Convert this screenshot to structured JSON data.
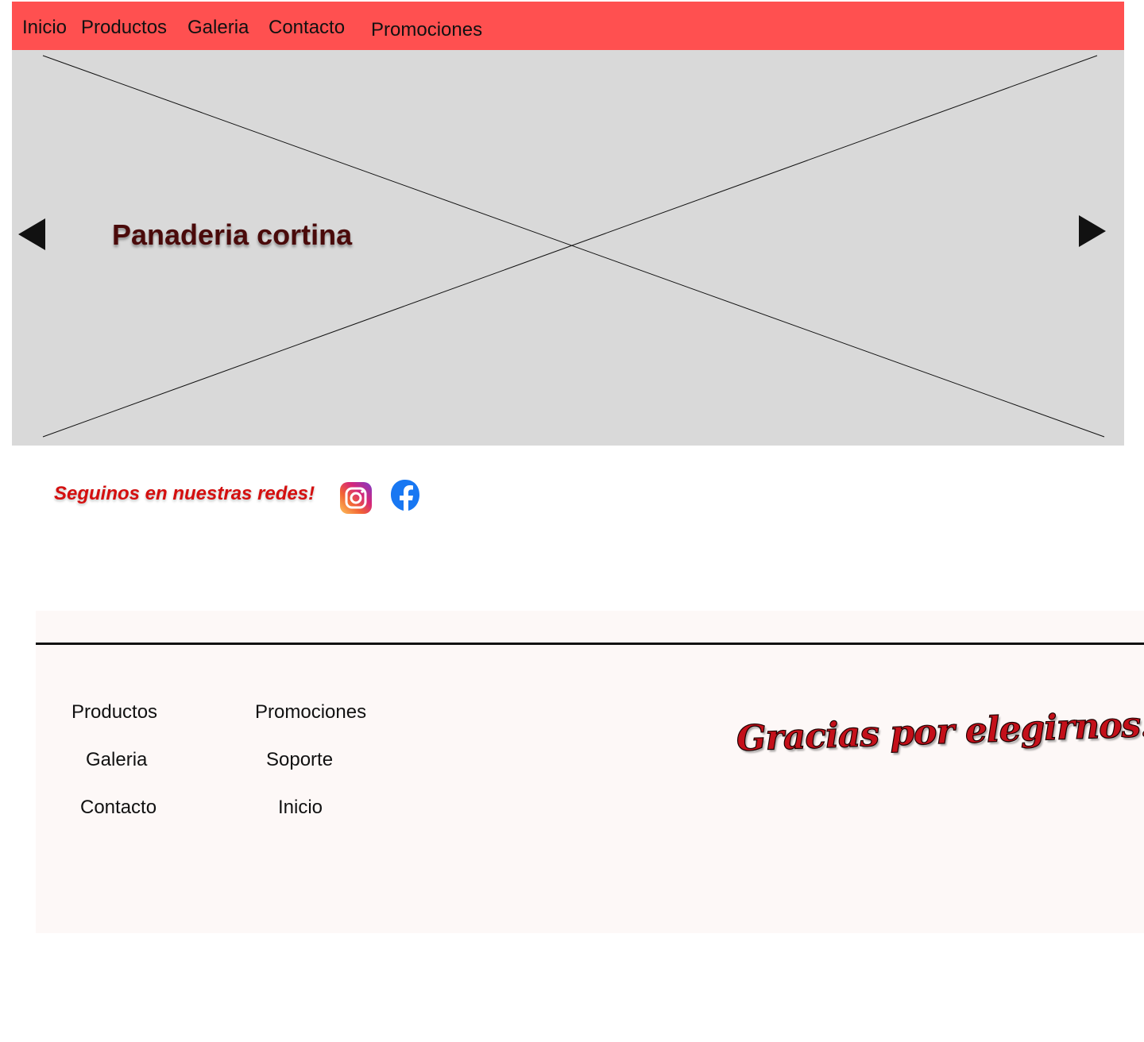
{
  "nav": {
    "items": [
      {
        "label": "Inicio"
      },
      {
        "label": "Productos"
      },
      {
        "label": "Galeria"
      },
      {
        "label": "Contacto"
      },
      {
        "label": "Promociones"
      }
    ]
  },
  "hero": {
    "title": "Panaderia cortina",
    "prev_icon": "triangle-left-icon",
    "next_icon": "triangle-right-icon"
  },
  "social": {
    "text": "Seguinos en nuestras redes!",
    "icons": [
      "instagram-icon",
      "facebook-icon"
    ]
  },
  "footer": {
    "col1": [
      {
        "label": "Productos"
      },
      {
        "label": "Galeria"
      },
      {
        "label": "Contacto"
      }
    ],
    "col2": [
      {
        "label": "Promociones"
      },
      {
        "label": "Soporte"
      },
      {
        "label": "Inicio"
      }
    ],
    "thanks": "Gracias por elegirnos!!"
  },
  "colors": {
    "nav_bg": "#ff5050",
    "hero_bg": "#d9d9d9",
    "hero_title": "#4a0a0a",
    "social_text": "#d40f0f",
    "footer_bg": "#fdf8f7",
    "thanks": "#c4101a"
  }
}
